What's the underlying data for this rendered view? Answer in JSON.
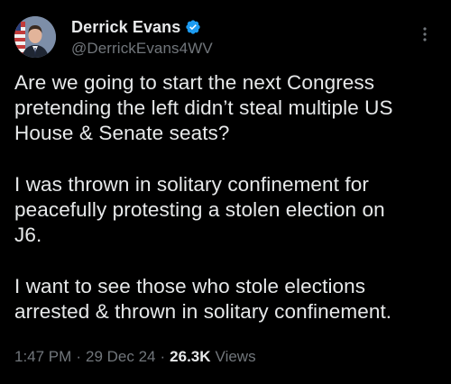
{
  "tweet": {
    "author": {
      "display_name": "Derrick Evans",
      "handle": "@DerrickEvans4WV",
      "verified": true,
      "verified_color": "#1d9bf0"
    },
    "paragraphs": [
      "Are we going to start the next Congress\npretending the left didn’t steal multiple US\nHouse & Senate seats?",
      "I was thrown in solitary confinement for\npeacefully protesting a stolen election on\nJ6.",
      "I want to see those who stole elections\narrested & thrown in solitary confinement."
    ],
    "meta": {
      "time": "1:47 PM",
      "separator": "·",
      "date": "29 Dec 24",
      "views_count": "26.3K",
      "views_label": "Views"
    }
  },
  "icons": {
    "verified": "verified-badge-icon",
    "more": "more-vertical-icon"
  }
}
